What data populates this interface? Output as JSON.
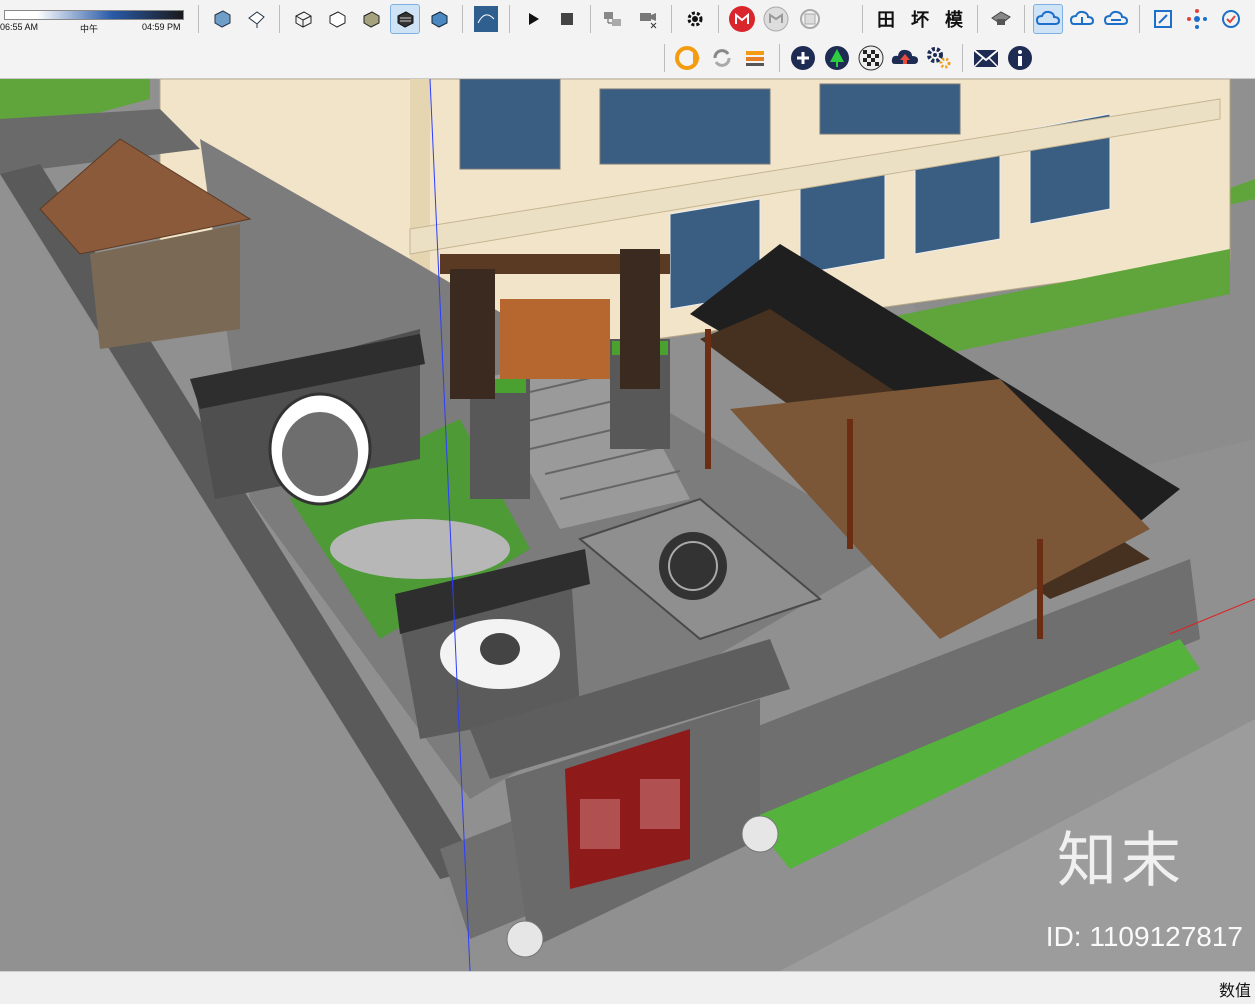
{
  "toolbar": {
    "time": {
      "start_label": "06:55 AM",
      "noon_label": "中午",
      "end_label": "04:59 PM"
    },
    "buttons_row1": [
      {
        "name": "iso-view-icon"
      },
      {
        "name": "top-view-icon"
      },
      {
        "name": "wireframe-icon"
      },
      {
        "name": "hidden-line-icon"
      },
      {
        "name": "shaded-icon"
      },
      {
        "name": "shaded-texture-icon"
      },
      {
        "name": "monochrome-icon"
      },
      {
        "name": "lumion-icon"
      },
      {
        "name": "play-icon"
      },
      {
        "name": "stop-icon"
      },
      {
        "name": "export-icon"
      },
      {
        "name": "camera-delete-icon"
      },
      {
        "name": "gear-icon"
      },
      {
        "name": "m-red-icon"
      },
      {
        "name": "m-gray-icon"
      },
      {
        "name": "sync-gray-icon"
      }
    ],
    "hanzi_buttons": [
      "田",
      "坏",
      "模"
    ],
    "buttons_row1_right": [
      {
        "name": "camera-gray-icon"
      },
      {
        "name": "cloud-sync-icon"
      },
      {
        "name": "cloud-up-icon"
      },
      {
        "name": "cloud-down-icon"
      },
      {
        "name": "fullscreen-icon"
      },
      {
        "name": "network-icon"
      },
      {
        "name": "refresh-check-icon"
      }
    ],
    "buttons_row2": [
      {
        "name": "enscape-icon"
      },
      {
        "name": "reload-icon"
      },
      {
        "name": "transfer-icon"
      },
      {
        "name": "add-circle-icon"
      },
      {
        "name": "tree-icon"
      },
      {
        "name": "checker-icon"
      },
      {
        "name": "cloud-upload-icon"
      },
      {
        "name": "settings-gears-icon"
      },
      {
        "name": "mail-icon"
      },
      {
        "name": "info-icon"
      }
    ]
  },
  "viewport": {
    "watermark": "知末",
    "watermark_id": "ID: 1109127817"
  },
  "statusbar": {
    "right_text": "数值"
  }
}
